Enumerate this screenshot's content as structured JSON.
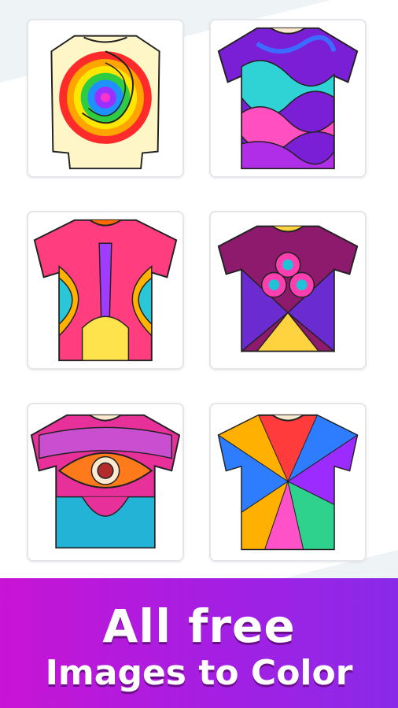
{
  "gallery": {
    "items": [
      {
        "label": "swirl-sweater",
        "colors": [
          "#ff2a2a",
          "#ffa500",
          "#ffe600",
          "#2ecc40",
          "#1e90ff",
          "#9b30ff",
          "#ff33cc"
        ]
      },
      {
        "label": "psychedelic-waves-tee",
        "colors": [
          "#7a1fd6",
          "#b02ee8",
          "#2fd3d6",
          "#ff4fc0",
          "#3b6cff"
        ]
      },
      {
        "label": "symmetric-arcs-tee",
        "colors": [
          "#ff3d7f",
          "#ffb300",
          "#ffe34d",
          "#29c7d8",
          "#a03cff",
          "#ff6a00"
        ]
      },
      {
        "label": "club-symbol-tee",
        "colors": [
          "#8e1a6e",
          "#6a2bd1",
          "#ff3fb0",
          "#ffd23f",
          "#1fc2d6"
        ]
      },
      {
        "label": "eye-pattern-tee",
        "colors": [
          "#e8309a",
          "#c94fd0",
          "#ff7a1a",
          "#22b3d6",
          "#b32b2b"
        ]
      },
      {
        "label": "radial-stripes-tee",
        "colors": [
          "#ff3b3b",
          "#ffb000",
          "#2e7dff",
          "#9c2bff",
          "#2fd28c",
          "#ff52c8"
        ]
      }
    ]
  },
  "banner": {
    "line1": "All free",
    "line2": "Images to Color",
    "gradient_start": "#c814d4",
    "gradient_end": "#8a2ae8"
  }
}
